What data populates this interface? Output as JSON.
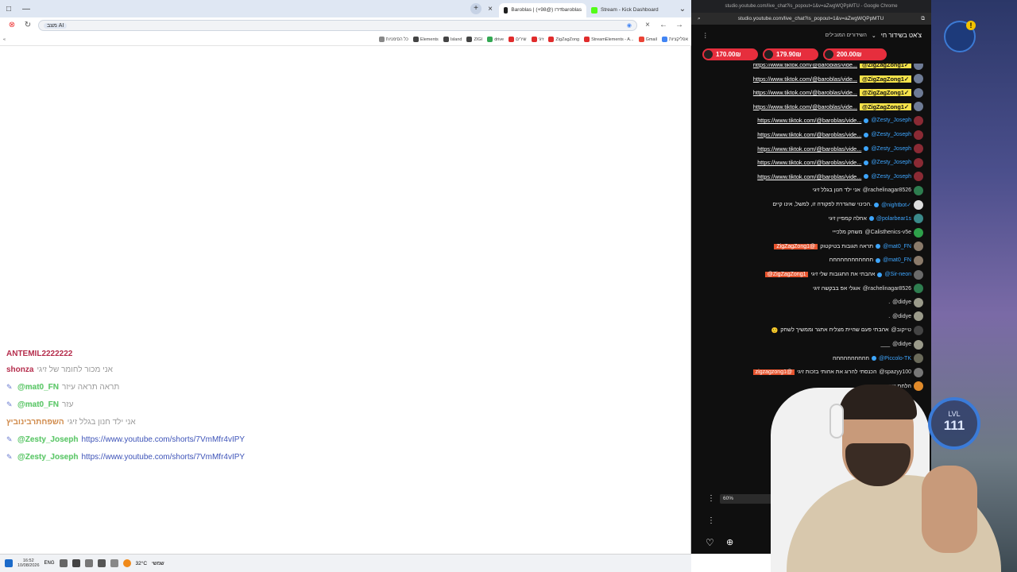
{
  "browser": {
    "tabs": [
      {
        "label": "Baroblas | זירו (@98+)baroblas",
        "color": "#1f1f1f",
        "active": true
      },
      {
        "label": "Stream - Kick Dashboard",
        "color": "#53fc18",
        "active": false
      }
    ],
    "new_tab_label": "+",
    "url": "מצב AI",
    "bookmarks": [
      {
        "label": "אפליקציות",
        "color": "#4285f4"
      },
      {
        "label": "Gmail",
        "color": "#ea4335"
      },
      {
        "label": "StreamElements - A...",
        "color": "#e02c2c"
      },
      {
        "label": "ZigZagZong",
        "color": "#e02c2c"
      },
      {
        "label": "זיגי",
        "color": "#e02c2c"
      },
      {
        "label": "שירים",
        "color": "#e02c2c"
      },
      {
        "label": "drive",
        "color": "#34a853"
      },
      {
        "label": "ZIGI",
        "color": "#444444"
      },
      {
        "label": "Island",
        "color": "#444444"
      },
      {
        "label": "Elements",
        "color": "#444444"
      },
      {
        "label": "כל הסימניות",
        "color": "#888888"
      }
    ]
  },
  "overlay_chat": [
    {
      "user": "ANTEMIL2222222",
      "text": "",
      "style": "red",
      "icon": false
    },
    {
      "user": "shonza",
      "text": "אני מכור לחומר של זיגי",
      "style": "red",
      "icon": false
    },
    {
      "user": "@mat0_FN",
      "text": "תראה תראה עיזר",
      "style": "green",
      "icon": true
    },
    {
      "user": "@mat0_FN",
      "text": "עזר",
      "style": "green",
      "icon": true
    },
    {
      "user": "השפחתרבינוביץ",
      "text": "אני ילד חנון בגלל זיגי",
      "style": "orange",
      "icon": false
    },
    {
      "user": "@Zesty_Joseph",
      "text": "https://www.youtube.com/shorts/7VmMfr4vIPY",
      "style": "green",
      "icon": true
    },
    {
      "user": "@Zesty_Joseph",
      "text": "https://www.youtube.com/shorts/7VmMfr4vIPY",
      "style": "green",
      "icon": true
    }
  ],
  "taskbar": {
    "time": "16:52",
    "date": "10/08/2026",
    "lang": "ENG",
    "weather": "32°C",
    "weather_label": "שמשי"
  },
  "popout": {
    "window_title": "studio.youtube.com/live_chat?is_popout=1&v=aZwgWQPpMTU - Google Chrome",
    "url": "studio.youtube.com/live_chat?is_popout=1&v=aZwgWQPpMTU",
    "header_title": "צ'אט בשידור חי",
    "header_sub": "השידורים המובילים",
    "superchats": [
      {
        "amount": "170.00₪"
      },
      {
        "amount": "179.90₪"
      },
      {
        "amount": "200.00₪"
      }
    ],
    "messages": [
      {
        "kind": "link",
        "text": "https://www.tiktok.com/@baroblas/vide...",
        "mention": "@ZigZagZong1✓",
        "mstyle": "yellow",
        "av": "#6e7b95"
      },
      {
        "kind": "link",
        "text": "https://www.tiktok.com/@baroblas/vide...",
        "mention": "@ZigZagZong1✓",
        "mstyle": "yellow",
        "av": "#6e7b95"
      },
      {
        "kind": "link",
        "text": "https://www.tiktok.com/@baroblas/vide...",
        "mention": "@ZigZagZong1✓",
        "mstyle": "yellow",
        "av": "#6e7b95"
      },
      {
        "kind": "link",
        "text": "https://www.tiktok.com/@baroblas/vide...",
        "mention": "@ZigZagZong1✓",
        "mstyle": "yellow",
        "av": "#6e7b95"
      },
      {
        "kind": "link",
        "text": "https://www.tiktok.com/@baroblas/vide...",
        "mention": "@Zesty_Joseph",
        "mstyle": "blue",
        "av": "#8a2a34"
      },
      {
        "kind": "link",
        "text": "https://www.tiktok.com/@baroblas/vide...",
        "mention": "@Zesty_Joseph",
        "mstyle": "blue",
        "av": "#8a2a34"
      },
      {
        "kind": "link",
        "text": "https://www.tiktok.com/@baroblas/vide...",
        "mention": "@Zesty_Joseph",
        "mstyle": "blue",
        "av": "#8a2a34"
      },
      {
        "kind": "link",
        "text": "https://www.tiktok.com/@baroblas/vide...",
        "mention": "@Zesty_Joseph",
        "mstyle": "blue",
        "av": "#8a2a34"
      },
      {
        "kind": "link",
        "text": "https://www.tiktok.com/@baroblas/vide...",
        "mention": "@Zesty_Joseph",
        "mstyle": "blue",
        "av": "#8a2a34"
      },
      {
        "kind": "text",
        "text": "אני ילד חנון בגלל זיגי",
        "mention": "@rachelinagar8526",
        "mstyle": "white",
        "av": "#2e7d4f"
      },
      {
        "kind": "text",
        "text": "הכינוי שהגדרת לפקודה זו, למשל, אינו קיים.",
        "mention": "@nightbot✓",
        "mstyle": "blue",
        "av": "#dddddd"
      },
      {
        "kind": "text",
        "text": "אחלה קמפיין זיגי",
        "mention": "@polarbear1s",
        "mstyle": "blue",
        "av": "#3a8a8a"
      },
      {
        "kind": "text",
        "text": "משחק מלכייי",
        "mention": "@Calisthenics-v5e",
        "mstyle": "white",
        "av": "#2ea04a"
      },
      {
        "kind": "text",
        "text": "תראה תגובות בטיקטוק",
        "mention": "@mat0_FN",
        "mstyle": "blue",
        "lead": "ZigZagZong1@",
        "av": "#8a7a6a"
      },
      {
        "kind": "text",
        "text": "חחחחחחחחחחחח",
        "mention": "@mat0_FN",
        "mstyle": "blue",
        "av": "#8a7a6a"
      },
      {
        "kind": "text",
        "text": "אהבתי את התגובות שלי זיגי",
        "mention": "@Sir-neon",
        "mstyle": "blue",
        "lead": "@ZigZagZong1",
        "av": "#6a6a6a"
      },
      {
        "kind": "text",
        "text": "אוגלי אפ בבקשה זיגי",
        "mention": "@rachelinagar8526",
        "mstyle": "white",
        "av": "#2e7d4f"
      },
      {
        "kind": "text",
        "text": ".",
        "mention": "@didye",
        "mstyle": "white",
        "av": "#9a9a8a"
      },
      {
        "kind": "text",
        "text": ".",
        "mention": "@didye",
        "mstyle": "white",
        "av": "#9a9a8a"
      },
      {
        "kind": "text",
        "text": "אהבתי פעם שהיית מצליח אתגר וממשיך לשחק",
        "mention": "@טייקוב",
        "mstyle": "white",
        "lead": "🙂",
        "av": "#444444"
      },
      {
        "kind": "text",
        "text": "___",
        "mention": "@didye",
        "mstyle": "white",
        "av": "#9a9a8a"
      },
      {
        "kind": "text",
        "text": "חחחחחחחחחח",
        "mention": "@Piccolo-TK",
        "mstyle": "blue",
        "av": "#6a6a5a"
      },
      {
        "kind": "text",
        "text": "הכנסתי להרוג את אחותי בזכות זיגי",
        "mention": "@spazyy100",
        "mstyle": "white",
        "lead": "zigzagzong1@",
        "av": "#777777"
      },
      {
        "kind": "text",
        "text": "הלחת שמח יהונתן",
        "mention": "",
        "mstyle": "white",
        "av": "#e08a2a"
      }
    ],
    "zoom": "60%"
  },
  "stream": {
    "level_label": "LVL",
    "level": "111",
    "alert": "!"
  }
}
